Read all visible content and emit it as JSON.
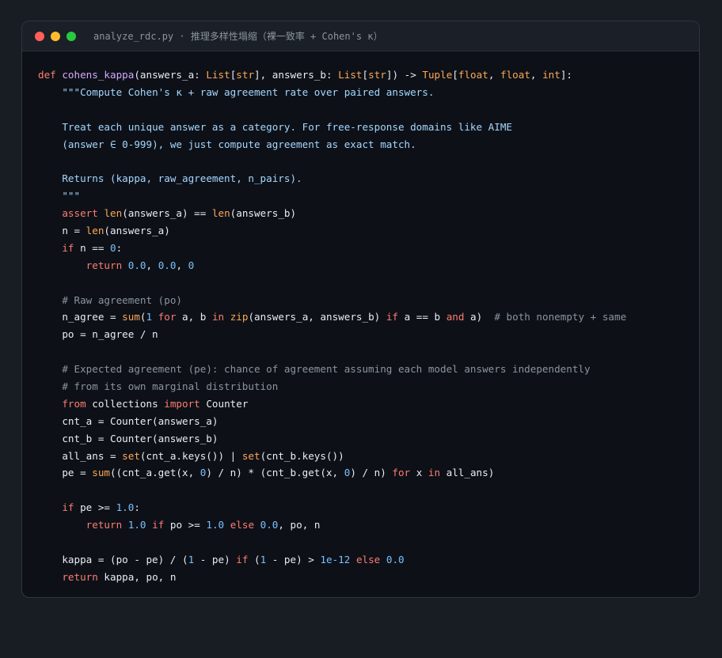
{
  "window": {
    "title": "analyze_rdc.py · 推理多样性塌缩（裸一致率 + Cohen's κ）",
    "controls": {
      "close_color": "#ff5f57",
      "minimize_color": "#febc2e",
      "maximize_color": "#28c840"
    }
  },
  "editor": {
    "language": "python",
    "lines": [
      [
        [
          "kw",
          "def"
        ],
        [
          "plain",
          " "
        ],
        [
          "fn",
          "cohens_kappa"
        ],
        [
          "plain",
          "(answers_a: "
        ],
        [
          "type",
          "List"
        ],
        [
          "plain",
          "["
        ],
        [
          "type",
          "str"
        ],
        [
          "plain",
          "], answers_b: "
        ],
        [
          "type",
          "List"
        ],
        [
          "plain",
          "["
        ],
        [
          "type",
          "str"
        ],
        [
          "plain",
          "]) -> "
        ],
        [
          "type",
          "Tuple"
        ],
        [
          "plain",
          "["
        ],
        [
          "type",
          "float"
        ],
        [
          "plain",
          ", "
        ],
        [
          "type",
          "float"
        ],
        [
          "plain",
          ", "
        ],
        [
          "type",
          "int"
        ],
        [
          "plain",
          "]:"
        ]
      ],
      [
        [
          "plain",
          "    "
        ],
        [
          "str",
          "\"\"\"Compute Cohen's κ + raw agreement rate over paired answers."
        ]
      ],
      [],
      [
        [
          "plain",
          "    "
        ],
        [
          "str",
          "Treat each unique answer as a category. For free-response domains like AIME"
        ]
      ],
      [
        [
          "plain",
          "    "
        ],
        [
          "str",
          "(answer ∈ 0-999), we just compute agreement as exact match."
        ]
      ],
      [],
      [
        [
          "plain",
          "    "
        ],
        [
          "str",
          "Returns (kappa, raw_agreement, n_pairs)."
        ]
      ],
      [
        [
          "plain",
          "    "
        ],
        [
          "str",
          "\"\"\""
        ]
      ],
      [
        [
          "plain",
          "    "
        ],
        [
          "kw",
          "assert"
        ],
        [
          "plain",
          " "
        ],
        [
          "builtin",
          "len"
        ],
        [
          "plain",
          "(answers_a) == "
        ],
        [
          "builtin",
          "len"
        ],
        [
          "plain",
          "(answers_b)"
        ]
      ],
      [
        [
          "plain",
          "    n = "
        ],
        [
          "builtin",
          "len"
        ],
        [
          "plain",
          "(answers_a)"
        ]
      ],
      [
        [
          "plain",
          "    "
        ],
        [
          "kw",
          "if"
        ],
        [
          "plain",
          " n == "
        ],
        [
          "num",
          "0"
        ],
        [
          "plain",
          ":"
        ]
      ],
      [
        [
          "plain",
          "        "
        ],
        [
          "kw",
          "return"
        ],
        [
          "plain",
          " "
        ],
        [
          "num",
          "0.0"
        ],
        [
          "plain",
          ", "
        ],
        [
          "num",
          "0.0"
        ],
        [
          "plain",
          ", "
        ],
        [
          "num",
          "0"
        ]
      ],
      [],
      [
        [
          "plain",
          "    "
        ],
        [
          "comment",
          "# Raw agreement (po)"
        ]
      ],
      [
        [
          "plain",
          "    n_agree = "
        ],
        [
          "builtin",
          "sum"
        ],
        [
          "plain",
          "("
        ],
        [
          "num",
          "1"
        ],
        [
          "plain",
          " "
        ],
        [
          "kw",
          "for"
        ],
        [
          "plain",
          " a, b "
        ],
        [
          "kw",
          "in"
        ],
        [
          "plain",
          " "
        ],
        [
          "builtin",
          "zip"
        ],
        [
          "plain",
          "(answers_a, answers_b) "
        ],
        [
          "kw",
          "if"
        ],
        [
          "plain",
          " a == b "
        ],
        [
          "kw",
          "and"
        ],
        [
          "plain",
          " a)  "
        ],
        [
          "comment",
          "# both nonempty + same"
        ]
      ],
      [
        [
          "plain",
          "    po = n_agree / n"
        ]
      ],
      [],
      [
        [
          "plain",
          "    "
        ],
        [
          "comment",
          "# Expected agreement (pe): chance of agreement assuming each model answers independently"
        ]
      ],
      [
        [
          "plain",
          "    "
        ],
        [
          "comment",
          "# from its own marginal distribution"
        ]
      ],
      [
        [
          "plain",
          "    "
        ],
        [
          "kw",
          "from"
        ],
        [
          "plain",
          " collections "
        ],
        [
          "kw",
          "import"
        ],
        [
          "plain",
          " Counter"
        ]
      ],
      [
        [
          "plain",
          "    cnt_a = Counter(answers_a)"
        ]
      ],
      [
        [
          "plain",
          "    cnt_b = Counter(answers_b)"
        ]
      ],
      [
        [
          "plain",
          "    all_ans = "
        ],
        [
          "builtin",
          "set"
        ],
        [
          "plain",
          "(cnt_a.keys()) | "
        ],
        [
          "builtin",
          "set"
        ],
        [
          "plain",
          "(cnt_b.keys())"
        ]
      ],
      [
        [
          "plain",
          "    pe = "
        ],
        [
          "builtin",
          "sum"
        ],
        [
          "plain",
          "((cnt_a.get(x, "
        ],
        [
          "num",
          "0"
        ],
        [
          "plain",
          ") / n) * (cnt_b.get(x, "
        ],
        [
          "num",
          "0"
        ],
        [
          "plain",
          ") / n) "
        ],
        [
          "kw",
          "for"
        ],
        [
          "plain",
          " x "
        ],
        [
          "kw",
          "in"
        ],
        [
          "plain",
          " all_ans)"
        ]
      ],
      [],
      [
        [
          "plain",
          "    "
        ],
        [
          "kw",
          "if"
        ],
        [
          "plain",
          " pe >= "
        ],
        [
          "num",
          "1.0"
        ],
        [
          "plain",
          ":"
        ]
      ],
      [
        [
          "plain",
          "        "
        ],
        [
          "kw",
          "return"
        ],
        [
          "plain",
          " "
        ],
        [
          "num",
          "1.0"
        ],
        [
          "plain",
          " "
        ],
        [
          "kw",
          "if"
        ],
        [
          "plain",
          " po >= "
        ],
        [
          "num",
          "1.0"
        ],
        [
          "plain",
          " "
        ],
        [
          "kw",
          "else"
        ],
        [
          "plain",
          " "
        ],
        [
          "num",
          "0.0"
        ],
        [
          "plain",
          ", po, n"
        ]
      ],
      [],
      [
        [
          "plain",
          "    kappa = (po - pe) / ("
        ],
        [
          "num",
          "1"
        ],
        [
          "plain",
          " - pe) "
        ],
        [
          "kw",
          "if"
        ],
        [
          "plain",
          " ("
        ],
        [
          "num",
          "1"
        ],
        [
          "plain",
          " - pe) > "
        ],
        [
          "num",
          "1e-12"
        ],
        [
          "plain",
          " "
        ],
        [
          "kw",
          "else"
        ],
        [
          "plain",
          " "
        ],
        [
          "num",
          "0.0"
        ]
      ],
      [
        [
          "plain",
          "    "
        ],
        [
          "kw",
          "return"
        ],
        [
          "plain",
          " kappa, po, n"
        ]
      ]
    ]
  }
}
